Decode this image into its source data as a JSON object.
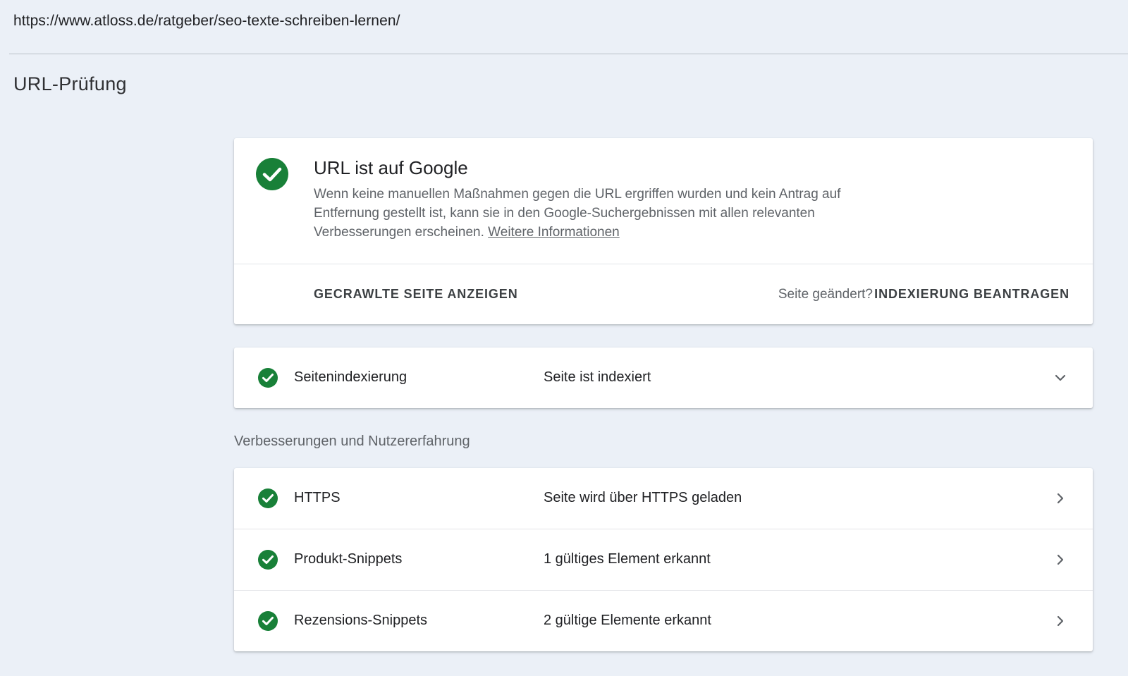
{
  "inspected_url": "https://www.atloss.de/ratgeber/seo-texte-schreiben-lernen/",
  "page_title": "URL-Prüfung",
  "status": {
    "heading": "URL ist auf Google",
    "description": "Wenn keine manuellen Maßnahmen gegen die URL ergriffen wurden und kein Antrag auf Entfernung gestellt ist, kann sie in den Google-Suchergebnissen mit allen relevanten Verbesserungen erscheinen.",
    "more_info_link": "Weitere Informationen",
    "icon": "check-circle-icon"
  },
  "actions": {
    "view_crawled": "GECRAWLTE SEITE ANZEIGEN",
    "page_changed": "Seite geändert?",
    "request_indexing": "INDEXIERUNG BEANTRAGEN"
  },
  "indexing": {
    "name": "Seitenindexierung",
    "status": "Seite ist indexiert",
    "icon": "check-circle-icon",
    "chevron": "chevron-down-icon"
  },
  "enhancements_label": "Verbesserungen und Nutzererfahrung",
  "enhancements": [
    {
      "name": "HTTPS",
      "status": "Seite wird über HTTPS geladen",
      "icon": "check-circle-icon"
    },
    {
      "name": "Produkt-Snippets",
      "status": "1 gültiges Element erkannt",
      "icon": "check-circle-icon"
    },
    {
      "name": "Rezensions-Snippets",
      "status": "2 gültige Elemente erkannt",
      "icon": "check-circle-icon"
    }
  ],
  "colors": {
    "success_green": "#188038",
    "background": "#ebf0f7",
    "card": "#ffffff",
    "secondary_text": "#5f6368"
  }
}
